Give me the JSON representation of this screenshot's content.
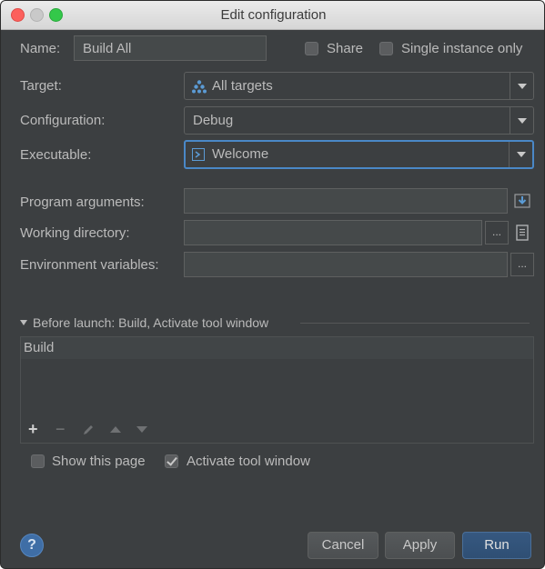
{
  "window": {
    "title": "Edit configuration"
  },
  "name": {
    "label": "Name:",
    "value": "Build All"
  },
  "share": {
    "label": "Share",
    "checked": false
  },
  "single_instance": {
    "label": "Single instance only",
    "checked": false
  },
  "target": {
    "label": "Target:",
    "value": "All targets",
    "icon": "targets-icon"
  },
  "configuration": {
    "label": "Configuration:",
    "value": "Debug"
  },
  "executable": {
    "label": "Executable:",
    "value": "Welcome",
    "icon": "executable-icon"
  },
  "program_arguments": {
    "label": "Program arguments:",
    "value": ""
  },
  "working_directory": {
    "label": "Working directory:",
    "value": ""
  },
  "environment_variables": {
    "label": "Environment variables:",
    "value": ""
  },
  "before_launch": {
    "header": "Before launch: Build, Activate tool window",
    "items": [
      "Build"
    ]
  },
  "ellipsis": "...",
  "toolbar": {
    "add": "+",
    "remove": "−"
  },
  "show_this_page": {
    "label": "Show this page",
    "checked": false
  },
  "activate_tool_window": {
    "label": "Activate tool window",
    "checked": true
  },
  "buttons": {
    "help": "?",
    "cancel": "Cancel",
    "apply": "Apply",
    "run": "Run"
  },
  "colors": {
    "background": "#3c3f41",
    "focus": "#4a88c7",
    "primary": "#365880"
  }
}
